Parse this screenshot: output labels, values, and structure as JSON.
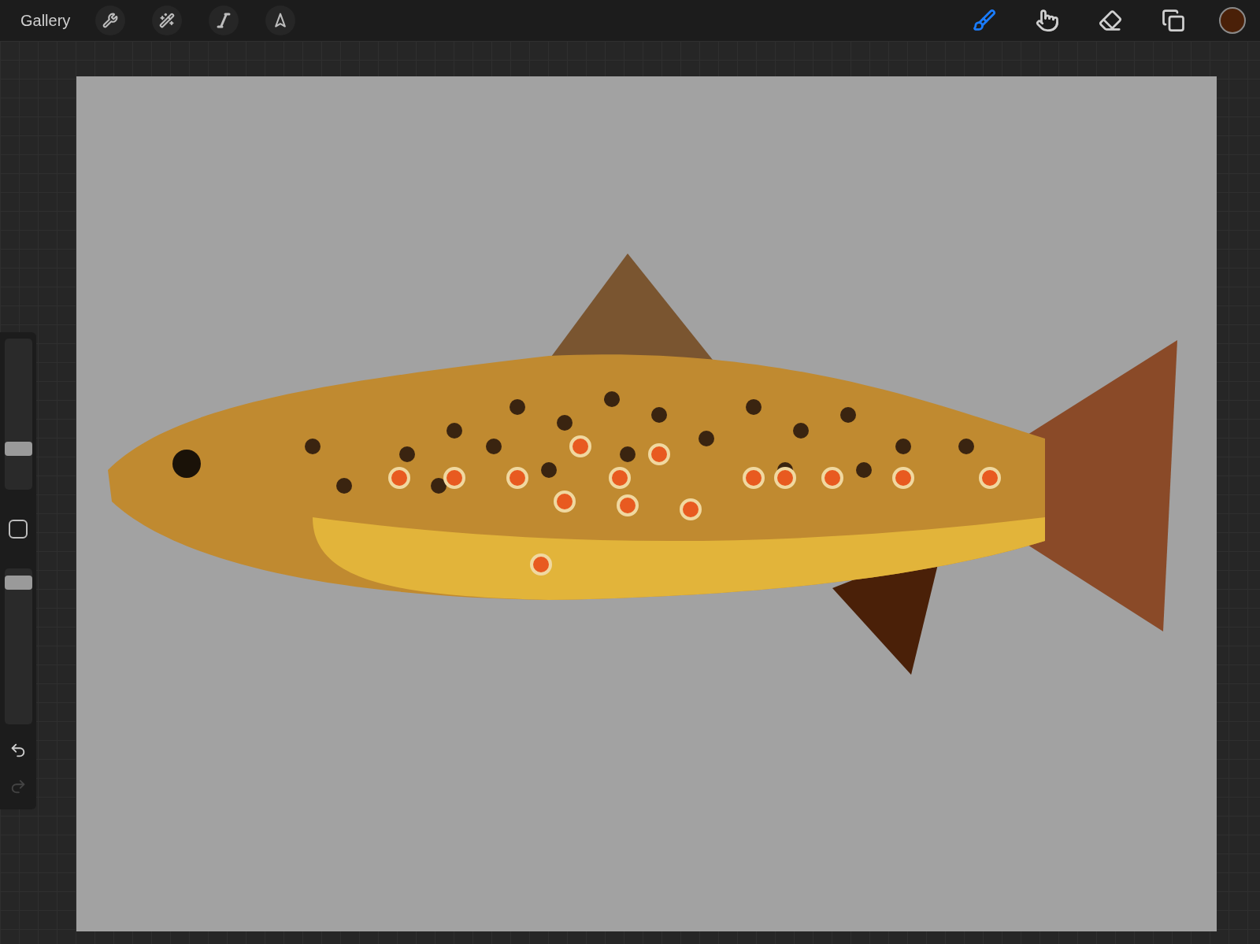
{
  "top_bar": {
    "gallery": "Gallery",
    "left_tools": [
      {
        "kind": "wrench"
      },
      {
        "kind": "wand"
      },
      {
        "kind": "selection"
      },
      {
        "kind": "transform"
      }
    ],
    "right_tools": [
      {
        "kind": "brush",
        "selected": true
      },
      {
        "kind": "smudge",
        "selected": false
      },
      {
        "kind": "eraser",
        "selected": false
      },
      {
        "kind": "layers",
        "selected": false
      }
    ],
    "color": "#4a2008"
  },
  "sidebar": {
    "size_slider": {
      "level": 0.25
    },
    "opacity_slider": {
      "level": 0.95
    },
    "undo": {
      "disabled": false
    },
    "redo": {
      "disabled": true
    }
  }
}
